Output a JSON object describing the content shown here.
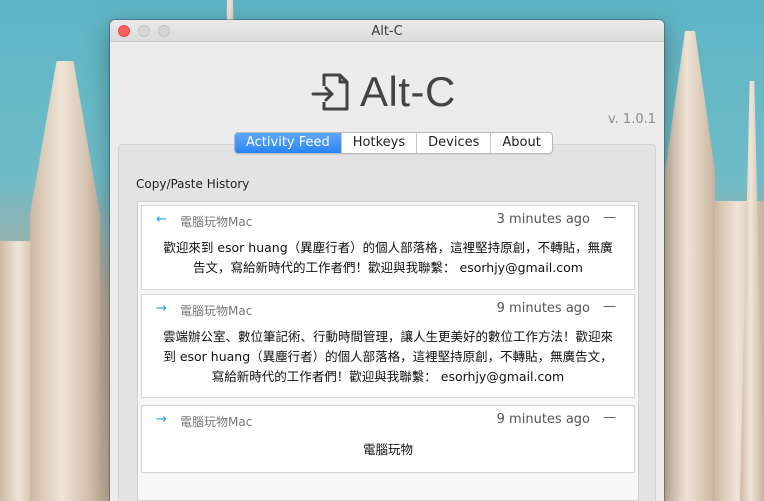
{
  "window": {
    "title": "Alt-C"
  },
  "header": {
    "app_name": "Alt-C",
    "version": "v. 1.0.1"
  },
  "tabs": [
    {
      "label": "Activity Feed",
      "active": true
    },
    {
      "label": "Hotkeys",
      "active": false
    },
    {
      "label": "Devices",
      "active": false
    },
    {
      "label": "About",
      "active": false
    }
  ],
  "history": {
    "label": "Copy/Paste History",
    "items": [
      {
        "direction": "received",
        "arrow": "←",
        "device": "電腦玩物Mac",
        "time": "3 minutes ago",
        "menu": "—",
        "lines": [
          "歡迎來到 esor huang（異塵行者）的個人部落格，這裡堅持原創，不轉貼，無廣",
          "告文，寫給新時代的工作者們！歡迎與我聯繫： esorhjy@gmail.com"
        ]
      },
      {
        "direction": "sent",
        "arrow": "→",
        "device": "電腦玩物Mac",
        "time": "9 minutes ago",
        "menu": "—",
        "lines": [
          "雲端辦公室、數位筆記術、行動時間管理，讓人生更美好的數位工作方法！歡迎來",
          "到 esor huang（異塵行者）的個人部落格，這裡堅持原創，不轉貼，無廣告文，",
          "寫給新時代的工作者們！歡迎與我聯繫： esorhjy@gmail.com"
        ]
      },
      {
        "direction": "sent",
        "arrow": "→",
        "device": "電腦玩物Mac",
        "time": "9 minutes ago",
        "menu": "—",
        "lines": [
          "電腦玩物"
        ]
      }
    ]
  },
  "colors": {
    "accent": "#2a84f5",
    "arrow": "#1aa3d9",
    "close": "#fc605c"
  }
}
